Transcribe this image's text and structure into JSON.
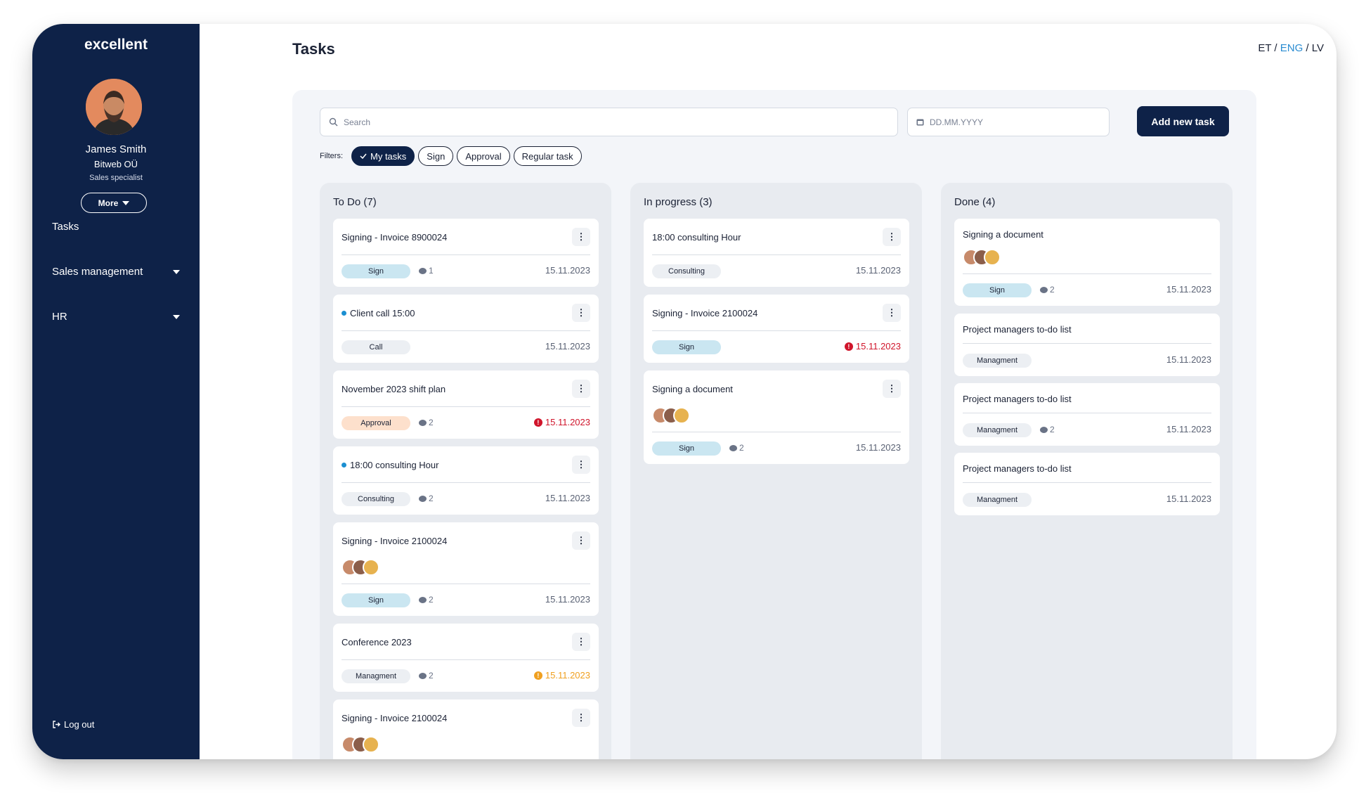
{
  "sidebar": {
    "logo": "excellent",
    "user": {
      "name": "James Smith",
      "company": "Bitweb OÜ",
      "role": "Sales specialist"
    },
    "more_label": "More",
    "nav": [
      {
        "label": "Tasks"
      },
      {
        "label": "Sales management"
      },
      {
        "label": "HR"
      }
    ],
    "logout_label": "Log out"
  },
  "header": {
    "title": "Tasks",
    "languages": [
      "ET",
      "ENG",
      "LV"
    ],
    "active_language": "ENG",
    "separator": "/"
  },
  "toolbar": {
    "search_placeholder": "Search",
    "date_placeholder": "DD.MM.YYYY",
    "add_label": "Add new task",
    "filters_label": "Filters:",
    "filters": [
      {
        "label": "My tasks",
        "active": true
      },
      {
        "label": "Sign",
        "active": false
      },
      {
        "label": "Approval",
        "active": false
      },
      {
        "label": "Regular task",
        "active": false
      }
    ]
  },
  "columns": [
    {
      "title": "To Do (7)",
      "cards": [
        {
          "title": "Signing - Invoice 8900024",
          "tag": "Sign",
          "comments": "1",
          "date": "15.11.2023"
        },
        {
          "title": "Client call 15:00",
          "dot": true,
          "tag": "Call",
          "date": "15.11.2023"
        },
        {
          "title": "November 2023 shift plan",
          "tag": "Approval",
          "comments": "2",
          "date": "15.11.2023",
          "status": "overdue"
        },
        {
          "title": "18:00 consulting Hour",
          "dot": true,
          "tag": "Consulting",
          "comments": "2",
          "date": "15.11.2023"
        },
        {
          "title": "Signing - Invoice 2100024",
          "avatars": true,
          "tag": "Sign",
          "comments": "2",
          "date": "15.11.2023"
        },
        {
          "title": "Conference 2023",
          "tag": "Managment",
          "comments": "2",
          "date": "15.11.2023",
          "status": "warning"
        },
        {
          "title": "Signing - Invoice 2100024",
          "avatars": true
        }
      ]
    },
    {
      "title": "In progress (3)",
      "cards": [
        {
          "title": "18:00 consulting Hour",
          "tag": "Consulting",
          "date": "15.11.2023"
        },
        {
          "title": "Signing - Invoice 2100024",
          "tag": "Sign",
          "date": "15.11.2023",
          "status": "overdue"
        },
        {
          "title": "Signing a document",
          "avatars": true,
          "tag": "Sign",
          "comments": "2",
          "date": "15.11.2023"
        }
      ]
    },
    {
      "title": "Done (4)",
      "cards": [
        {
          "title": "Signing a document",
          "avatars": true,
          "tag": "Sign",
          "comments": "2",
          "date": "15.11.2023"
        },
        {
          "title": "Project managers to-do list",
          "tag": "Managment",
          "date": "15.11.2023"
        },
        {
          "title": "Project managers to-do list",
          "tag": "Managment",
          "comments": "2",
          "date": "15.11.2023"
        },
        {
          "title": "Project managers to-do list",
          "tag": "Managment",
          "date": "15.11.2023"
        }
      ]
    }
  ],
  "colors": {
    "sidebar": "#0e2248",
    "accent": "#2a8cd2",
    "tag_sign": "#cae6f1",
    "tag_approval": "#fde0cc",
    "tag_default": "#eceff3",
    "overdue": "#d0152b",
    "warning": "#f0a020"
  },
  "icons": {
    "search": "search-icon",
    "calendar": "calendar-icon",
    "more": "kebab-icon",
    "comment": "comment-icon",
    "logout": "logout-icon",
    "check": "check-icon"
  }
}
